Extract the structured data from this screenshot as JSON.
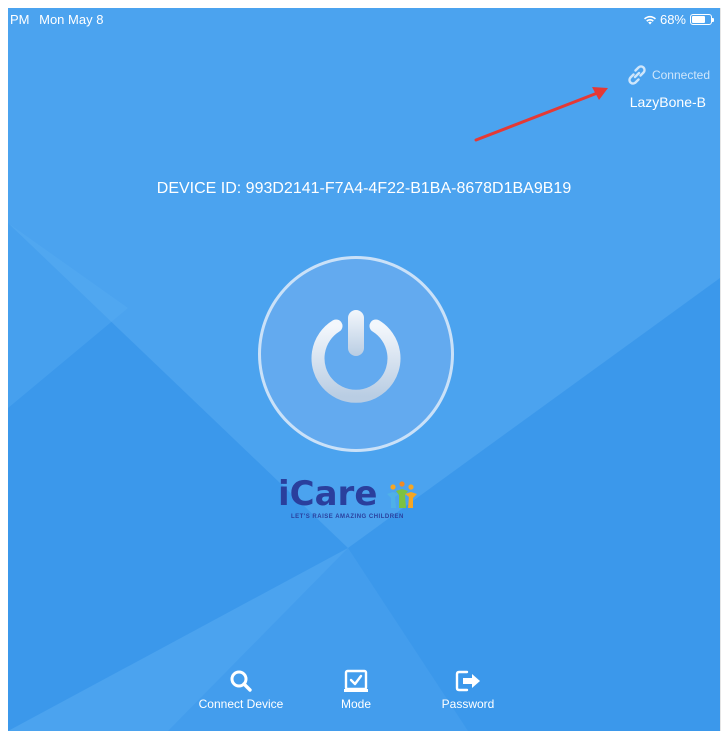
{
  "status_bar": {
    "time": "PM",
    "date": "Mon May 8",
    "battery": "68%"
  },
  "connection": {
    "status": "Connected",
    "device_name": "LazyBone-B"
  },
  "device": {
    "id_text": "DEVICE ID: 993D2141-F7A4-4F22-B1BA-8678D1BA9B19"
  },
  "logo": {
    "name": "iCare",
    "tagline": "LET'S RAISE AMAZING CHILDREN"
  },
  "tabs": [
    {
      "label": "Connect Device",
      "icon": "search-icon"
    },
    {
      "label": "Mode",
      "icon": "checkbox-icon"
    },
    {
      "label": "Password",
      "icon": "logout-icon"
    }
  ],
  "colors": {
    "background": "#4ba3ef",
    "annotation_arrow": "#e53935",
    "logo": "#2a3f9d"
  }
}
